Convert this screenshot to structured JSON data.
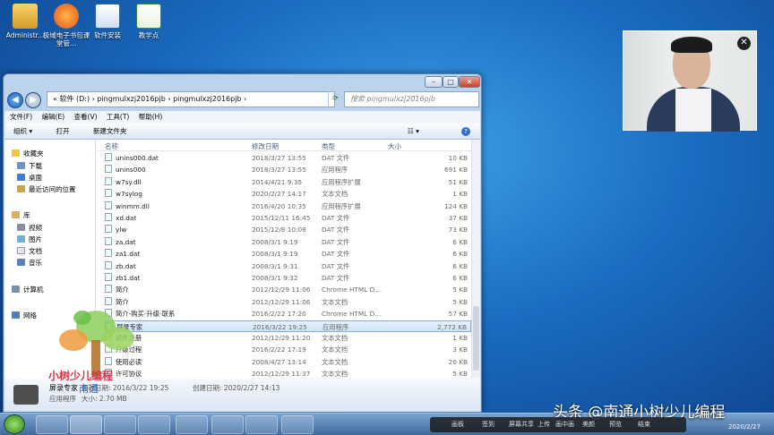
{
  "desktop": {
    "icons": [
      {
        "label": "Administr...",
        "icon": "user-folder-icon"
      },
      {
        "label": "极域电子书包课堂管...",
        "icon": "classroom-app-icon"
      },
      {
        "label": "软件安装",
        "icon": "word-doc-icon"
      },
      {
        "label": "教学点",
        "icon": "spreadsheet-icon"
      }
    ]
  },
  "window": {
    "address": "« 软件 (D:)  ›  pingmulxzj2016pjb  ›  pingmulxzj2016pjb  ›",
    "search_placeholder": "搜索 pingmulxzj2016pjb",
    "menu": [
      "文件(F)",
      "编辑(E)",
      "查看(V)",
      "工具(T)",
      "帮助(H)"
    ],
    "toolbar": [
      "组织 ▾",
      "打开",
      "新建文件夹"
    ],
    "nav": {
      "favorites": {
        "label": "收藏夹",
        "items": [
          "下载",
          "桌面",
          "最近访问的位置"
        ]
      },
      "libraries": {
        "label": "库",
        "items": [
          "视频",
          "图片",
          "文档",
          "音乐"
        ]
      },
      "computer": "计算机",
      "network": "网络"
    },
    "columns": {
      "name": "名称",
      "date": "修改日期",
      "type": "类型",
      "size": "大小"
    },
    "files": [
      {
        "name": "unins000.dat",
        "date": "2018/3/27 13:55",
        "type": "DAT 文件",
        "size": "10 KB"
      },
      {
        "name": "unins000",
        "date": "2018/3/27 13:55",
        "type": "应用程序",
        "size": "691 KB"
      },
      {
        "name": "w7sy.dll",
        "date": "2014/4/21 9:35",
        "type": "应用程序扩展",
        "size": "51 KB"
      },
      {
        "name": "w7sylog",
        "date": "2020/2/27 14:17",
        "type": "文本文档",
        "size": "1 KB"
      },
      {
        "name": "winmm.dll",
        "date": "2016/4/20 10:35",
        "type": "应用程序扩展",
        "size": "124 KB"
      },
      {
        "name": "xd.dat",
        "date": "2015/12/11 16:45",
        "type": "DAT 文件",
        "size": "37 KB"
      },
      {
        "name": "ylw",
        "date": "2015/12/8 10:08",
        "type": "DAT 文件",
        "size": "73 KB"
      },
      {
        "name": "za.dat",
        "date": "2008/3/1 9:19",
        "type": "DAT 文件",
        "size": "6 KB"
      },
      {
        "name": "za1.dat",
        "date": "2008/3/1 9:19",
        "type": "DAT 文件",
        "size": "6 KB"
      },
      {
        "name": "zb.dat",
        "date": "2008/3/1 9:31",
        "type": "DAT 文件",
        "size": "6 KB"
      },
      {
        "name": "zb1.dat",
        "date": "2008/3/1 9:32",
        "type": "DAT 文件",
        "size": "6 KB"
      },
      {
        "name": "简介",
        "date": "2012/12/29 11:06",
        "type": "Chrome HTML D...",
        "size": "5 KB"
      },
      {
        "name": "简介",
        "date": "2012/12/29 11:06",
        "type": "文本文档",
        "size": "5 KB"
      },
      {
        "name": "简介-购买-升级-联系",
        "date": "2016/2/22 17:20",
        "type": "Chrome HTML D...",
        "size": "57 KB"
      },
      {
        "name": "屏录专家",
        "date": "2016/3/22 19:25",
        "type": "应用程序",
        "size": "2,772 KB"
      },
      {
        "name": "软件注册",
        "date": "2012/12/29 11:20",
        "type": "文本文档",
        "size": "1 KB"
      },
      {
        "name": "升级过程",
        "date": "2016/2/22 17:19",
        "type": "文本文档",
        "size": "3 KB"
      },
      {
        "name": "使用必读",
        "date": "2008/4/27 13:14",
        "type": "文本文档",
        "size": "20 KB"
      },
      {
        "name": "许可协议",
        "date": "2012/12/29 11:37",
        "type": "文本文档",
        "size": "5 KB"
      }
    ],
    "selected_index": 14,
    "details": {
      "name": "屏录专家",
      "modified": "修改日期: 2016/3/22 19:25",
      "created": "创建日期: 2020/2/27 14:13",
      "type": "应用程序",
      "size": "大小: 2.70 MB"
    }
  },
  "overlay": {
    "brand": "头条 @南通小树少儿编程",
    "logo_text": "南通",
    "logo_caption": "小树少儿编程",
    "lesson_tools": [
      "画板",
      "签到",
      "屏幕共享",
      "上传",
      "画中画",
      "美颜",
      "预览",
      "结束"
    ]
  },
  "taskbar": {
    "clock": "2020/2/27"
  }
}
